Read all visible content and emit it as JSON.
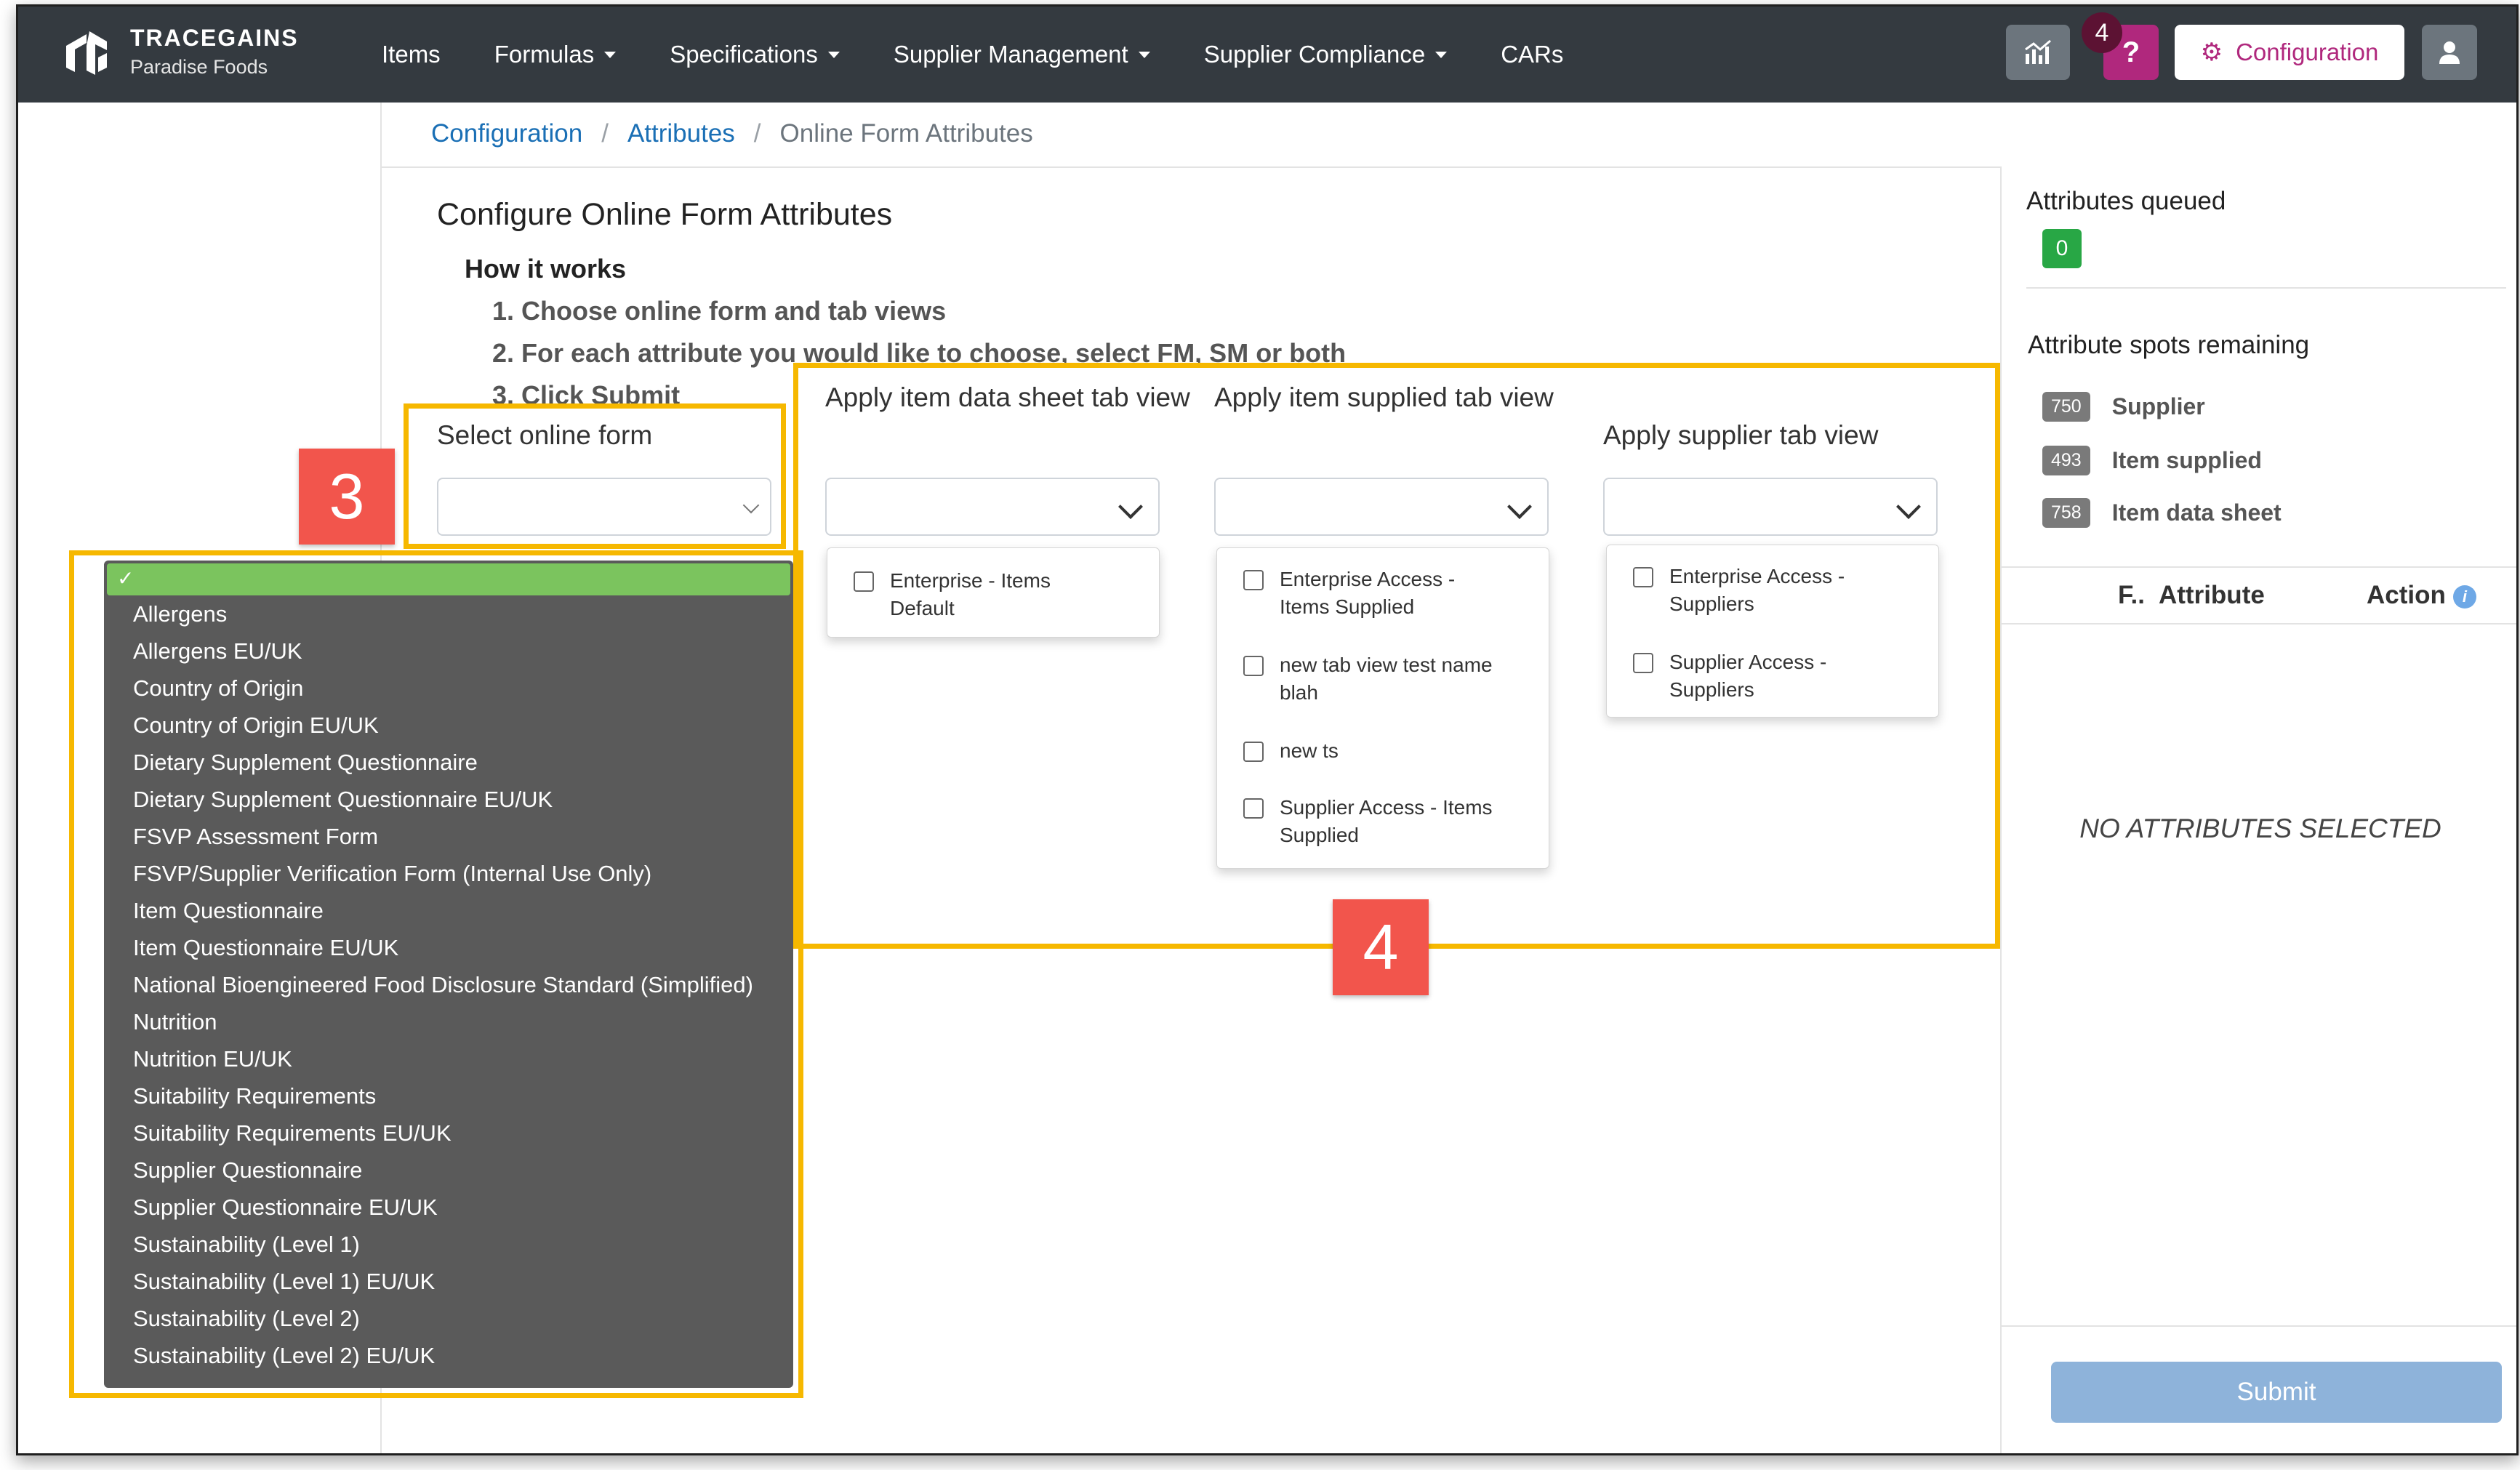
{
  "app": {
    "brand": "TRACEGAINS",
    "org": "Paradise Foods"
  },
  "nav": {
    "items": [
      {
        "label": "Items",
        "dropdown": false
      },
      {
        "label": "Formulas",
        "dropdown": true
      },
      {
        "label": "Specifications",
        "dropdown": true
      },
      {
        "label": "Supplier Management",
        "dropdown": true
      },
      {
        "label": "Supplier Compliance",
        "dropdown": true
      },
      {
        "label": "CARs",
        "dropdown": false
      }
    ],
    "help_label": "?",
    "help_badge": "4",
    "config_label": "Configuration"
  },
  "breadcrumb": {
    "c1": "Configuration",
    "c2": "Attributes",
    "c3": "Online Form Attributes"
  },
  "page": {
    "title": "Configure Online Form Attributes",
    "how": "How it works",
    "step1": "1. Choose online form and tab views",
    "step2": "2. For each attribute you would like to choose, select FM, SM or both",
    "step3": "3. Click Submit"
  },
  "form": {
    "online_form_label": "Select online form",
    "item_data_label": "Apply item data sheet tab view",
    "item_supplied_label": "Apply item supplied tab view",
    "supplier_label": "Apply supplier tab view",
    "item_data_options": [
      "Enterprise - Items Default"
    ],
    "item_supplied_options": [
      "Enterprise Access - Items Supplied",
      "new tab view test name blah",
      "new ts",
      "Supplier Access - Items Supplied"
    ],
    "supplier_options": [
      "Enterprise Access - Suppliers",
      "Supplier Access - Suppliers"
    ]
  },
  "online_forms": {
    "selected_mark": "✓",
    "options": [
      "Allergens",
      "Allergens EU/UK",
      "Country of Origin",
      "Country of Origin EU/UK",
      "Dietary Supplement Questionnaire",
      "Dietary Supplement Questionnaire EU/UK",
      "FSVP Assessment Form",
      "FSVP/Supplier Verification Form (Internal Use Only)",
      "Item Questionnaire",
      "Item Questionnaire EU/UK",
      "National Bioengineered Food Disclosure Standard (Simplified)",
      "Nutrition",
      "Nutrition EU/UK",
      "Suitability Requirements",
      "Suitability Requirements EU/UK",
      "Supplier Questionnaire",
      "Supplier Questionnaire EU/UK",
      "Sustainability (Level 1)",
      "Sustainability (Level 1) EU/UK",
      "Sustainability (Level 2)",
      "Sustainability (Level 2) EU/UK"
    ]
  },
  "markers": {
    "m3": "3",
    "m4": "4"
  },
  "sidebar": {
    "queued_title": "Attributes queued",
    "queued_count": "0",
    "spots_title": "Attribute spots remaining",
    "spots": [
      {
        "count": "750",
        "label": "Supplier"
      },
      {
        "count": "493",
        "label": "Item supplied"
      },
      {
        "count": "758",
        "label": "Item data sheet"
      }
    ],
    "col_f": "F..",
    "col_attr": "Attribute",
    "col_action": "Action",
    "info_glyph": "i",
    "empty": "NO ATTRIBUTES SELECTED",
    "submit": "Submit"
  },
  "colors": {
    "nav_bg": "#343a40",
    "accent": "#b0287d",
    "highlight": "#f6b800",
    "marker": "#f2554c",
    "success": "#28a745"
  }
}
